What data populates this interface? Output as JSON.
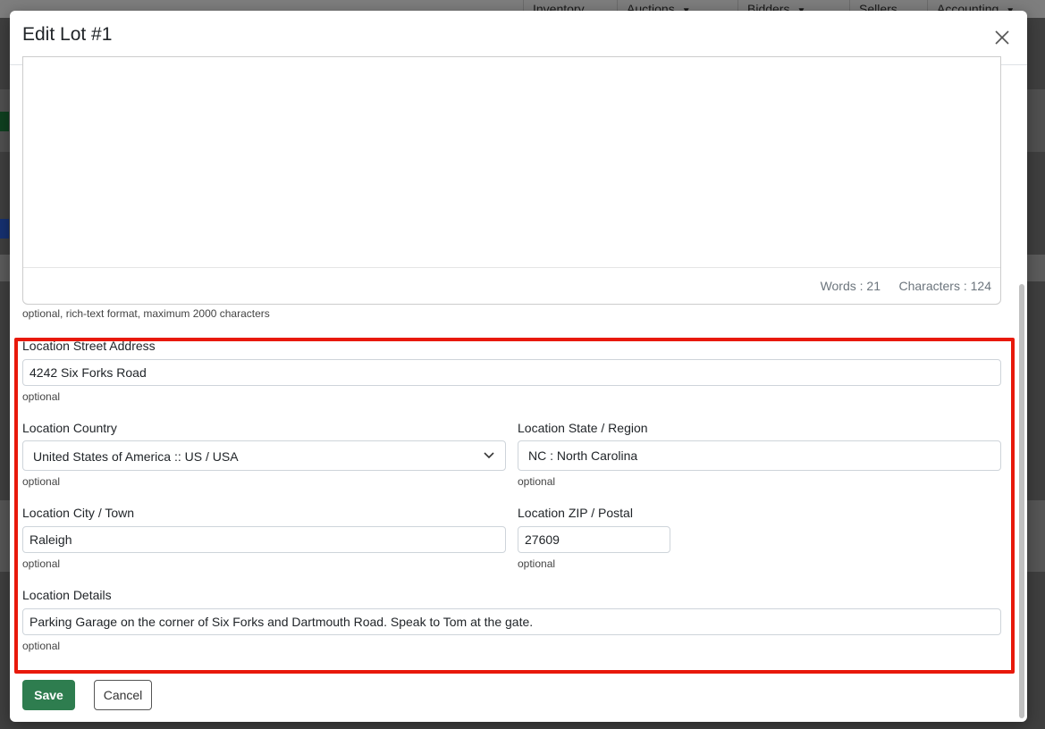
{
  "background_nav": {
    "tabs": [
      "Inventory",
      "Auctions",
      "Bidders",
      "Sellers",
      "Accounting"
    ]
  },
  "modal": {
    "title": "Edit Lot #1",
    "editor": {
      "words": "Words : 21",
      "characters": "Characters : 124",
      "help": "optional, rich-text format, maximum 2000 characters"
    },
    "fields": {
      "street": {
        "label": "Location Street Address",
        "value": "4242 Six Forks Road",
        "help": "optional"
      },
      "country": {
        "label": "Location Country",
        "value": "United States of America :: US / USA",
        "help": "optional"
      },
      "state": {
        "label": "Location State / Region",
        "value": "NC : North Carolina",
        "help": "optional"
      },
      "city": {
        "label": "Location City / Town",
        "value": "Raleigh",
        "help": "optional"
      },
      "zip": {
        "label": "Location ZIP / Postal",
        "value": "27609",
        "help": "optional"
      },
      "details": {
        "label": "Location Details",
        "value": "Parking Garage on the corner of Six Forks and Dartmouth Road. Speak to Tom at the gate.",
        "help": "optional"
      }
    },
    "buttons": {
      "save": "Save",
      "cancel": "Cancel"
    }
  },
  "colors": {
    "highlight": "#e8190b",
    "save_button": "#2e7d4f"
  }
}
